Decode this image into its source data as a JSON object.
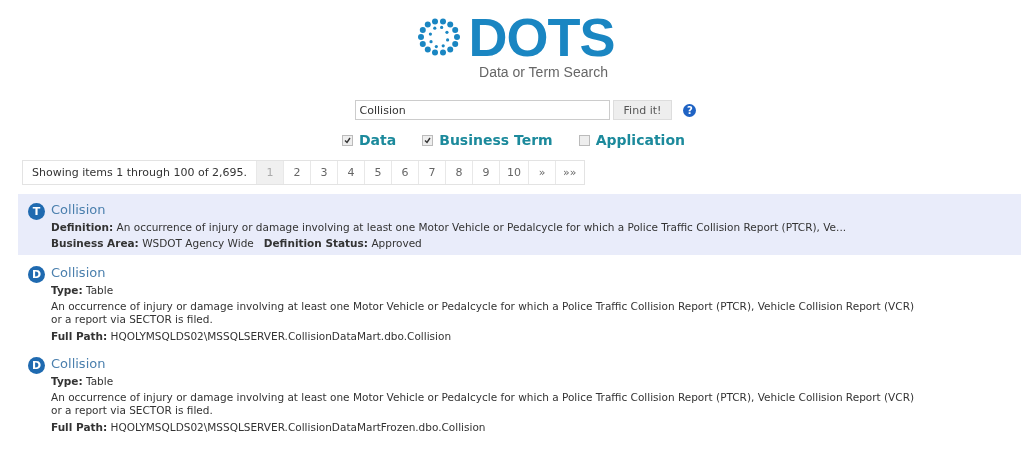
{
  "logo": {
    "title": "DOTS",
    "subtitle": "Data or Term Search"
  },
  "search": {
    "value": "Collision",
    "button": "Find it!",
    "help": "?"
  },
  "filters": [
    {
      "label": "Data",
      "checked": true
    },
    {
      "label": "Business Term",
      "checked": true
    },
    {
      "label": "Application",
      "checked": false
    }
  ],
  "pager": {
    "summary": "Showing items 1 through 100 of 2,695.",
    "pages": [
      {
        "label": "1",
        "selected": true
      },
      {
        "label": "2",
        "selected": false
      },
      {
        "label": "3",
        "selected": false
      },
      {
        "label": "4",
        "selected": false
      },
      {
        "label": "5",
        "selected": false
      },
      {
        "label": "6",
        "selected": false
      },
      {
        "label": "7",
        "selected": false
      },
      {
        "label": "8",
        "selected": false
      },
      {
        "label": "9",
        "selected": false
      },
      {
        "label": "10",
        "selected": false
      },
      {
        "label": "»",
        "selected": false
      },
      {
        "label": "»»",
        "selected": false
      }
    ]
  },
  "results": [
    {
      "badge": "T",
      "title": "Collision",
      "selected": true,
      "lines": [
        {
          "kind": "fields",
          "fields": [
            {
              "label": "Definition:",
              "value": "An occurrence of injury or damage involving at least one Motor Vehicle or Pedalcycle for which a Police Traffic Collision Report (PTCR), Ve..."
            }
          ]
        },
        {
          "kind": "fields",
          "fields": [
            {
              "label": "Business Area:",
              "value": "WSDOT Agency Wide"
            },
            {
              "label": "Definition Status:",
              "value": "Approved"
            }
          ]
        }
      ]
    },
    {
      "badge": "D",
      "title": "Collision",
      "selected": false,
      "lines": [
        {
          "kind": "fields",
          "fields": [
            {
              "label": "Type:",
              "value": "Table"
            }
          ]
        },
        {
          "kind": "text",
          "text": "An occurrence of injury or damage involving at least one Motor Vehicle or Pedalcycle for which a Police Traffic Collision Report (PTCR), Vehicle Collision Report (VCR) or a report via SECTOR is filed."
        },
        {
          "kind": "fields",
          "fields": [
            {
              "label": "Full Path:",
              "value": "HQOLYMSQLDS02\\MSSQLSERVER.CollisionDataMart.dbo.Collision"
            }
          ]
        }
      ]
    },
    {
      "badge": "D",
      "title": "Collision",
      "selected": false,
      "lines": [
        {
          "kind": "fields",
          "fields": [
            {
              "label": "Type:",
              "value": "Table"
            }
          ]
        },
        {
          "kind": "text",
          "text": "An occurrence of injury or damage involving at least one Motor Vehicle or Pedalcycle for which a Police Traffic Collision Report (PTCR), Vehicle Collision Report (VCR) or a report via SECTOR is filed."
        },
        {
          "kind": "fields",
          "fields": [
            {
              "label": "Full Path:",
              "value": "HQOLYMSQLDS02\\MSSQLSERVER.CollisionDataMartFrozen.dbo.Collision"
            }
          ]
        }
      ]
    }
  ]
}
